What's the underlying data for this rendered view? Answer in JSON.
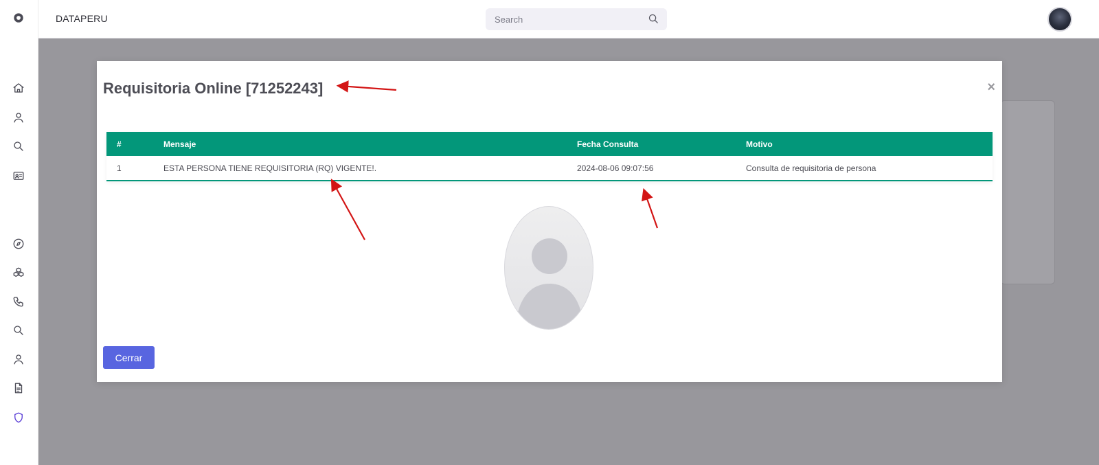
{
  "app": {
    "brand": "DATAPERU"
  },
  "search": {
    "placeholder": "Search",
    "icon": "search-icon"
  },
  "sidebar": {
    "items": [
      {
        "icon": "logo-icon"
      },
      {
        "icon": "home-icon"
      },
      {
        "icon": "user-icon"
      },
      {
        "icon": "search-icon"
      },
      {
        "icon": "id-card-icon"
      },
      {
        "icon": "compass-icon"
      },
      {
        "icon": "cubes-icon"
      },
      {
        "icon": "phone-icon"
      },
      {
        "icon": "search-icon"
      },
      {
        "icon": "user-icon"
      },
      {
        "icon": "document-icon"
      },
      {
        "icon": "shield-icon"
      }
    ],
    "active_color": "#5b3fd6"
  },
  "modal": {
    "title": "Requisitoria Online [71252243]",
    "close_label": "×",
    "close_button_label": "Cerrar"
  },
  "table": {
    "columns": [
      "#",
      "Mensaje",
      "Fecha Consulta",
      "Motivo"
    ],
    "rows": [
      {
        "n": "1",
        "mensaje": "ESTA PERSONA TIENE REQUISITORIA (RQ) VIGENTE!.",
        "fecha": "2024-08-06 09:07:56",
        "motivo": "Consulta de requisitoria de persona"
      }
    ]
  },
  "colors": {
    "table_header": "#03977a",
    "primary_button": "#5865e0",
    "overlay": "#98979c",
    "annotation_arrow": "#d31515"
  }
}
